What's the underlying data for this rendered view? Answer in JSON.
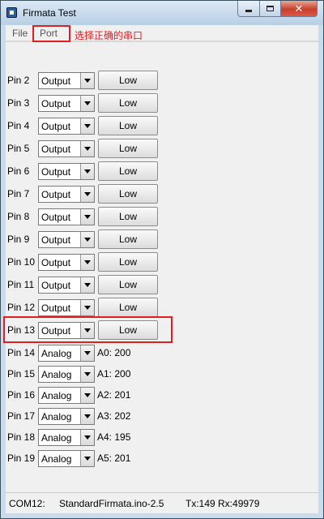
{
  "window": {
    "title": "Firmata Test"
  },
  "menu": {
    "file": "File",
    "port": "Port",
    "port_annotation": "选择正确的串口"
  },
  "digital_pins": [
    {
      "label": "Pin 2",
      "mode": "Output",
      "value": "Low"
    },
    {
      "label": "Pin 3",
      "mode": "Output",
      "value": "Low"
    },
    {
      "label": "Pin 4",
      "mode": "Output",
      "value": "Low"
    },
    {
      "label": "Pin 5",
      "mode": "Output",
      "value": "Low"
    },
    {
      "label": "Pin 6",
      "mode": "Output",
      "value": "Low"
    },
    {
      "label": "Pin 7",
      "mode": "Output",
      "value": "Low"
    },
    {
      "label": "Pin 8",
      "mode": "Output",
      "value": "Low"
    },
    {
      "label": "Pin 9",
      "mode": "Output",
      "value": "Low"
    },
    {
      "label": "Pin 10",
      "mode": "Output",
      "value": "Low"
    },
    {
      "label": "Pin 11",
      "mode": "Output",
      "value": "Low"
    },
    {
      "label": "Pin 12",
      "mode": "Output",
      "value": "Low"
    },
    {
      "label": "Pin 13",
      "mode": "Output",
      "value": "Low"
    }
  ],
  "analog_pins": [
    {
      "label": "Pin 14",
      "mode": "Analog",
      "reading": "A0: 200"
    },
    {
      "label": "Pin 15",
      "mode": "Analog",
      "reading": "A1: 200"
    },
    {
      "label": "Pin 16",
      "mode": "Analog",
      "reading": "A2: 201"
    },
    {
      "label": "Pin 17",
      "mode": "Analog",
      "reading": "A3: 202"
    },
    {
      "label": "Pin 18",
      "mode": "Analog",
      "reading": "A4: 195"
    },
    {
      "label": "Pin 19",
      "mode": "Analog",
      "reading": "A5: 201"
    }
  ],
  "status": {
    "port": "COM12:",
    "firmware": "StandardFirmata.ino-2.5",
    "traffic": "Tx:149 Rx:49979"
  },
  "colors": {
    "annotation": "#e02020"
  }
}
